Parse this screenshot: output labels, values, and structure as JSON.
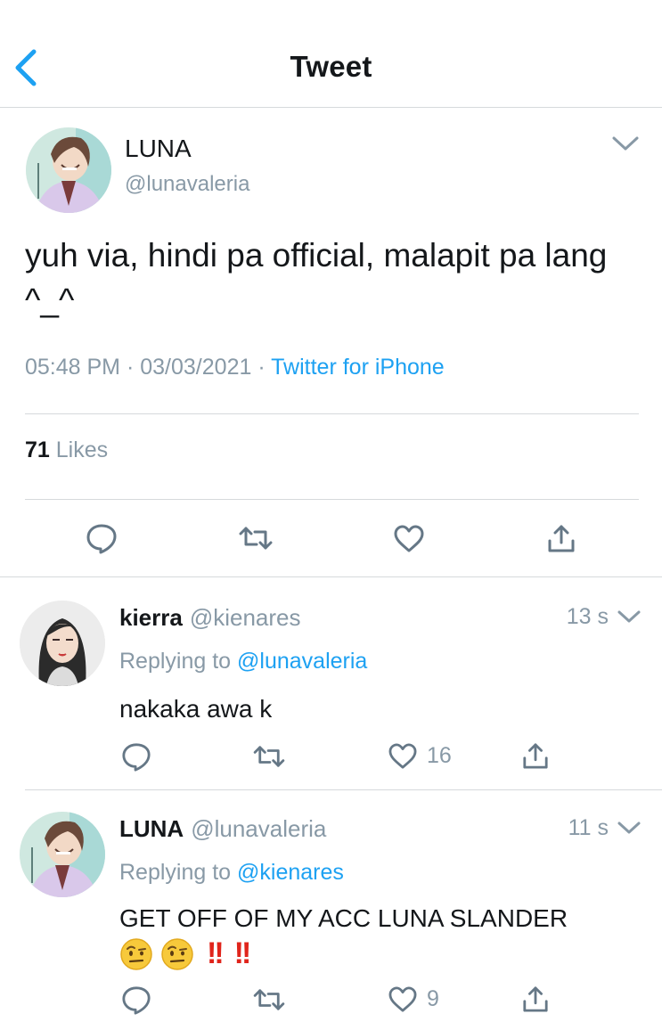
{
  "header": {
    "title": "Tweet"
  },
  "tweet": {
    "name": "LUNA",
    "handle": "@lunavaleria",
    "text": "yuh via, hindi pa official, malapit pa lang ^_^",
    "time": "05:48 PM",
    "date": "03/03/2021",
    "source": "Twitter for iPhone",
    "likes_count": "71",
    "likes_label": "Likes"
  },
  "replies": [
    {
      "name": "kierra",
      "handle": "@kienares",
      "time": "13 s",
      "replying_label": "Replying to",
      "replying_to": "@lunavaleria",
      "text": "nakaka awa k",
      "like_count": "16"
    },
    {
      "name": "LUNA",
      "handle": "@lunavaleria",
      "time": "11 s",
      "replying_label": "Replying to",
      "replying_to": "@kienares",
      "text": "GET OFF OF MY ACC LUNA SLANDER",
      "emojis": [
        "face-with-raised-eyebrow-icon",
        "face-with-raised-eyebrow-icon",
        "double-exclamation-icon",
        "double-exclamation-icon"
      ],
      "like_count": "9"
    }
  ],
  "colors": {
    "accent": "#1da1f2",
    "muted": "#8899a6",
    "text": "#14171a",
    "divider": "#d6d9dc",
    "alert": "#e0241b"
  }
}
